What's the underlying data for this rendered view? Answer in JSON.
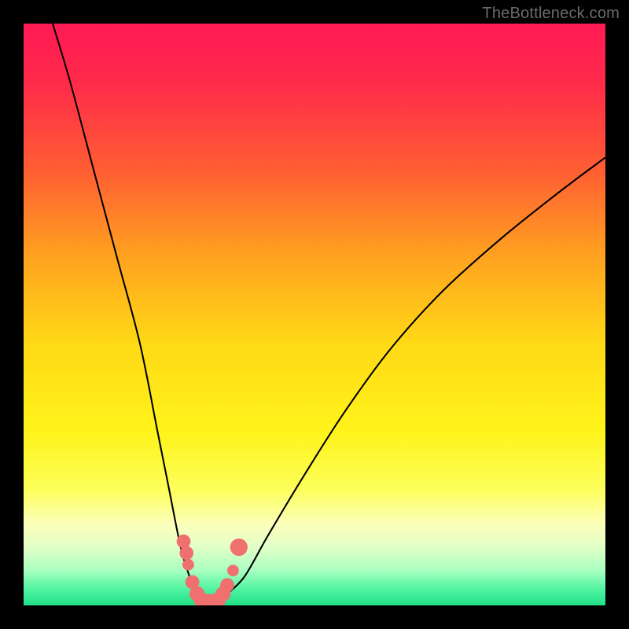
{
  "watermark": "TheBottleneck.com",
  "gradient_stops": [
    {
      "offset": 0.0,
      "color": "#ff1a55"
    },
    {
      "offset": 0.1,
      "color": "#ff2a4a"
    },
    {
      "offset": 0.25,
      "color": "#ff5d33"
    },
    {
      "offset": 0.4,
      "color": "#ffa21f"
    },
    {
      "offset": 0.55,
      "color": "#ffd916"
    },
    {
      "offset": 0.7,
      "color": "#fff31a"
    },
    {
      "offset": 0.8,
      "color": "#fdff5a"
    },
    {
      "offset": 0.86,
      "color": "#fcffba"
    },
    {
      "offset": 0.9,
      "color": "#e2ffc8"
    },
    {
      "offset": 0.94,
      "color": "#a9ffc0"
    },
    {
      "offset": 0.97,
      "color": "#55f5a3"
    },
    {
      "offset": 1.0,
      "color": "#20e088"
    }
  ],
  "chart_data": {
    "type": "line",
    "title": "",
    "xlabel": "",
    "ylabel": "",
    "xlim": [
      0,
      100
    ],
    "ylim": [
      0,
      100
    ],
    "series": [
      {
        "name": "curve-left",
        "x": [
          5,
          8,
          12,
          16,
          20,
          23,
          25,
          27,
          28.5,
          29.5
        ],
        "values": [
          100,
          90,
          75,
          60,
          45,
          30,
          20,
          10,
          5,
          2
        ]
      },
      {
        "name": "curve-right",
        "x": [
          35,
          38,
          42,
          48,
          55,
          63,
          72,
          82,
          92,
          100
        ],
        "values": [
          2,
          5,
          12,
          22,
          33,
          44,
          54,
          63,
          71,
          77
        ]
      }
    ],
    "valley": {
      "name": "valley-floor",
      "x": [
        29.5,
        30.5,
        31.5,
        32.5,
        33.5,
        34.5,
        35
      ],
      "values": [
        2,
        1,
        0.5,
        0.5,
        0.5,
        1,
        2
      ]
    },
    "markers": [
      {
        "x": 27.5,
        "y": 11,
        "r": 1.2
      },
      {
        "x": 28.0,
        "y": 9,
        "r": 1.2
      },
      {
        "x": 28.3,
        "y": 7,
        "r": 1.0
      },
      {
        "x": 29.0,
        "y": 4,
        "r": 1.2
      },
      {
        "x": 29.8,
        "y": 2,
        "r": 1.3
      },
      {
        "x": 30.5,
        "y": 1,
        "r": 1.3
      },
      {
        "x": 31.5,
        "y": 0.7,
        "r": 1.3
      },
      {
        "x": 32.5,
        "y": 0.7,
        "r": 1.3
      },
      {
        "x": 33.5,
        "y": 1,
        "r": 1.3
      },
      {
        "x": 34.3,
        "y": 2,
        "r": 1.3
      },
      {
        "x": 35.0,
        "y": 3.5,
        "r": 1.2
      },
      {
        "x": 36.0,
        "y": 6,
        "r": 1.0
      },
      {
        "x": 37.0,
        "y": 10,
        "r": 1.5
      }
    ],
    "marker_color": "#f07070",
    "line_color": "#000000"
  }
}
